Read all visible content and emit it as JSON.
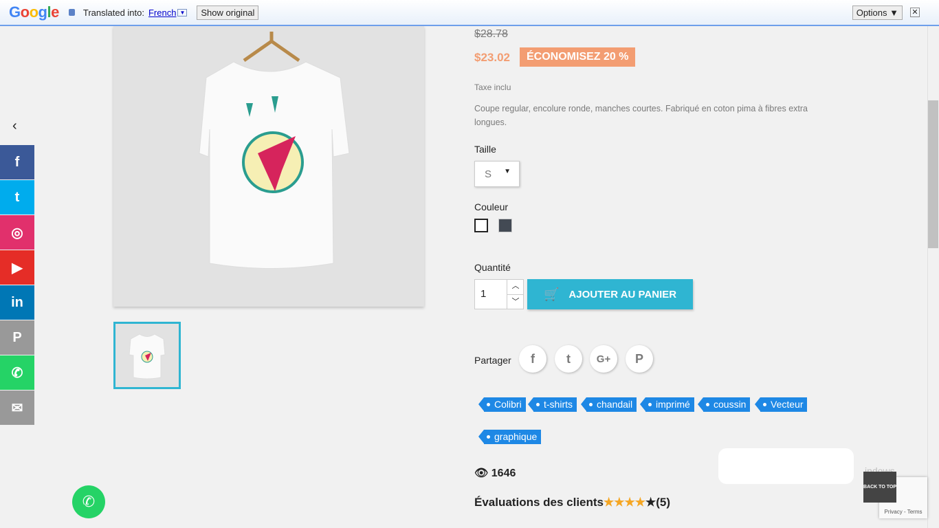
{
  "translate_bar": {
    "logo": "Google",
    "label": "Translated into:",
    "language": "French",
    "show_original": "Show original",
    "options": "Options ▼",
    "close": "✕"
  },
  "social": [
    {
      "name": "facebook",
      "color": "#3b5998",
      "glyph": "f"
    },
    {
      "name": "twitter",
      "color": "#00aced",
      "glyph": "t"
    },
    {
      "name": "instagram",
      "color": "#e1306c",
      "glyph": "◎"
    },
    {
      "name": "youtube",
      "color": "#e52d27",
      "glyph": "▶"
    },
    {
      "name": "linkedin",
      "color": "#0077b5",
      "glyph": "in"
    },
    {
      "name": "pinterest",
      "color": "#999999",
      "glyph": "P"
    },
    {
      "name": "whatsapp",
      "color": "#25d366",
      "glyph": "✆"
    },
    {
      "name": "email",
      "color": "#999999",
      "glyph": "✉"
    }
  ],
  "product": {
    "old_price": "$28.78",
    "price": "$23.02",
    "discount": "ÉCONOMISEZ 20 %",
    "tax": "Taxe inclu",
    "description": "Coupe regular, encolure ronde, manches courtes. Fabriqué en coton pima à fibres extra longues.",
    "size_label": "Taille",
    "size_value": "S",
    "color_label": "Couleur",
    "colors": [
      "#ffffff",
      "#434a54"
    ],
    "qty_label": "Quantité",
    "qty": "1",
    "add_to_cart": "AJOUTER AU PANIER",
    "share_label": "Partager",
    "tags": [
      "Colibri",
      "t-shirts",
      "chandail",
      "imprimé",
      "coussin",
      "Vecteur",
      "graphique"
    ],
    "views": "1646",
    "reviews_title": "Évaluations des clients",
    "rating": 4,
    "rating_max": 5,
    "reviews_count": "(5)"
  },
  "overlay": {
    "watermark": "indows.",
    "recaptcha": "Privacy - Terms",
    "back_to_top": "BACK TO TOP"
  },
  "colors": {
    "accent": "#2fb5d2",
    "discount": "#f39d72",
    "tag": "#1e88e5"
  }
}
